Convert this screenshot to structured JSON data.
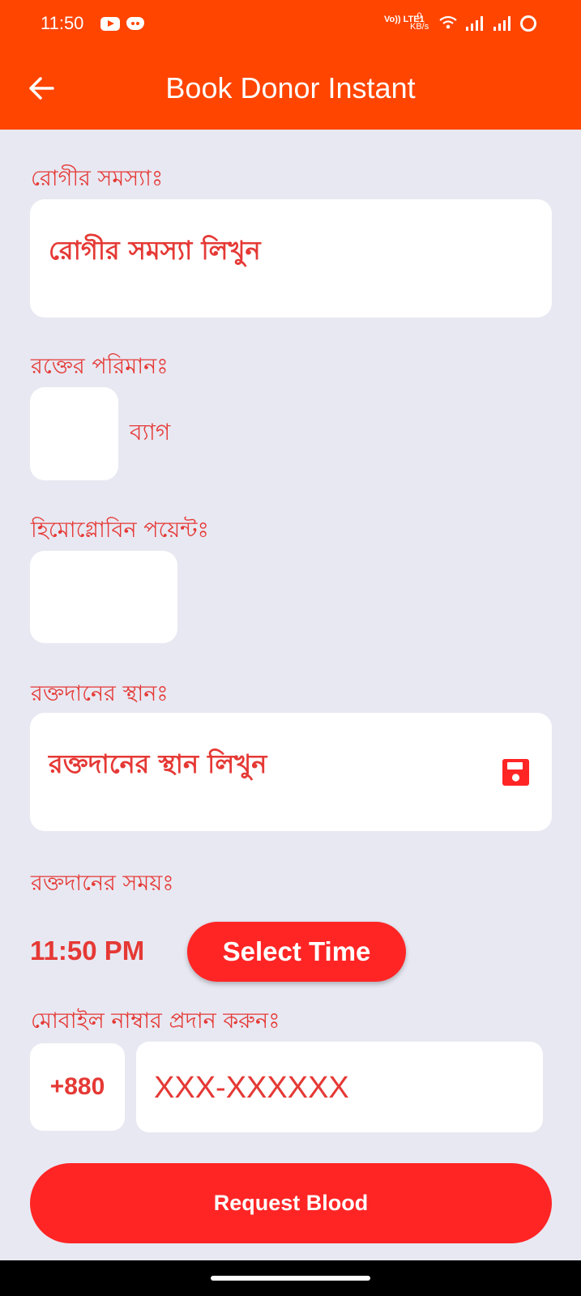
{
  "status_bar": {
    "time": "11:50",
    "network_indicator": "Vo)) LTE1",
    "data_rate_value": "0",
    "data_rate_unit": "KB/s",
    "icons": [
      "youtube-icon",
      "discord-icon",
      "wifi-icon",
      "signal-icon",
      "signal-icon",
      "loading-ring-icon"
    ]
  },
  "appbar": {
    "title": "Book Donor Instant",
    "back_icon": "arrow-left-icon",
    "background_color": "#ff4500"
  },
  "form": {
    "patient_problem": {
      "label": "রোগীর সমস্যাঃ",
      "placeholder": "রোগীর সমস্যা লিখুন"
    },
    "blood_amount": {
      "label": "রক্তের পরিমানঃ",
      "value": "",
      "unit": "ব্যাগ"
    },
    "hemoglobin": {
      "label": "হিমোগ্লোবিন পয়েন্টঃ",
      "value": ""
    },
    "donation_place": {
      "label": "রক্তদানের স্থানঃ",
      "placeholder": "রক্তদানের স্থান লিখুন",
      "icon": "save-icon"
    },
    "donation_time": {
      "label": "রক্তদানের সময়ঃ",
      "value": "11:50 PM",
      "button_label": "Select Time"
    },
    "mobile": {
      "label": "মোবাইল নাম্বার প্রদান করুনঃ",
      "country_code": "+880",
      "placeholder": "XXX-XXXXXX"
    }
  },
  "submit": {
    "label": "Request Blood"
  },
  "colors": {
    "accent": "#ff2525",
    "label_red": "#e53935",
    "background": "#e8e8f2"
  }
}
